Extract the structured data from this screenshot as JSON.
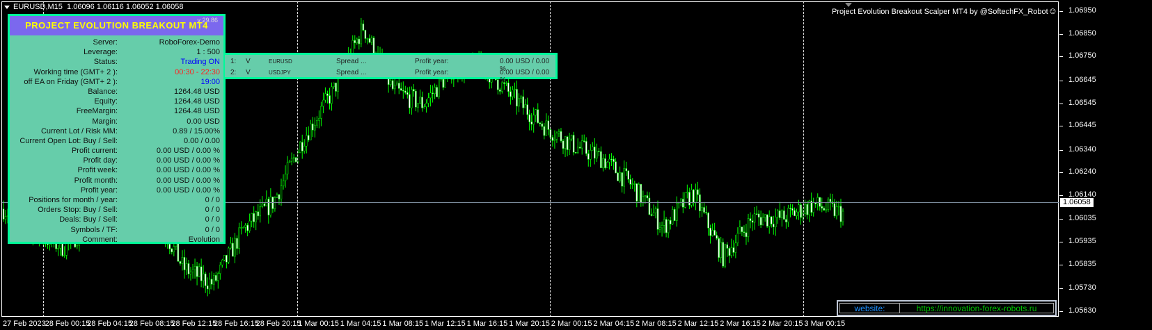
{
  "header": {
    "symbol": "EURUSD,M15",
    "ohlc": "1.06096 1.06116 1.06052 1.06058",
    "title_right": "Project Evolution Breakout Scalper MT4 by @SoftechFX_Robot",
    "smiley": "☺"
  },
  "panel": {
    "title": "PROJECT EVOLUTION BREAKOUT MT4",
    "version": "v 29.86",
    "rows": [
      {
        "k": "Server:",
        "v": "RoboForex-Demo",
        "c": "#111"
      },
      {
        "k": "Leverage:",
        "v": "1 : 500",
        "c": "#111"
      },
      {
        "k": "Status:",
        "v": "Trading ON",
        "c": "#0000ff"
      },
      {
        "k": "Working time (GMT+ 2 ):",
        "v": "00:30 - 22:30",
        "c": "#ff2020"
      },
      {
        "k": "off EA on Friday (GMT+ 2 ):",
        "v": "19:00",
        "c": "#0000ff"
      },
      {
        "k": "Balance:",
        "v": "1264.48 USD",
        "c": "#111"
      },
      {
        "k": "Equity:",
        "v": "1264.48 USD",
        "c": "#111"
      },
      {
        "k": "FreeMargin:",
        "v": "1264.48 USD",
        "c": "#111"
      },
      {
        "k": "Margin:",
        "v": "0.00 USD",
        "c": "#111"
      },
      {
        "k": "Current Lot / Risk MM:",
        "v": "0.89 / 15.00%",
        "c": "#111"
      },
      {
        "k": "Current Open Lot: Buy / Sell:",
        "v": "0.00  /  0.00",
        "c": "#111"
      },
      {
        "k": "Profit current:",
        "v": "0.00 USD / 0.00 %",
        "c": "#111"
      },
      {
        "k": "Profit day:",
        "v": "0.00 USD / 0.00 %",
        "c": "#111"
      },
      {
        "k": "Profit week:",
        "v": "0.00 USD / 0.00 %",
        "c": "#111"
      },
      {
        "k": "Profit month:",
        "v": "0.00 USD / 0.00 %",
        "c": "#111"
      },
      {
        "k": "Profit year:",
        "v": "0.00 USD / 0.00 %",
        "c": "#111"
      },
      {
        "k": "Positions for month / year:",
        "v": "0  /  0",
        "c": "#111"
      },
      {
        "k": "Orders Stop: Buy / Sell:",
        "v": "0  /  0",
        "c": "#111"
      },
      {
        "k": "Deals: Buy / Sell:",
        "v": "0  /  0",
        "c": "#111"
      },
      {
        "k": "Symbols / TF:",
        "v": "0  /  0",
        "c": "#111"
      },
      {
        "k": "Comment:",
        "v": "Evolution",
        "c": "#111"
      }
    ]
  },
  "symbols_panel": [
    {
      "n": "1:",
      "flag": "V",
      "sym": "EURUSD",
      "spread": "Spread ...",
      "pl": "Profit year:",
      "pv": "0.00 USD / 0.00 %"
    },
    {
      "n": "2:",
      "flag": "V",
      "sym": "USDJPY",
      "spread": "Spread ...",
      "pl": "Profit year:",
      "pv": "0.00 USD / 0.00 %"
    }
  ],
  "website": {
    "label": "website:",
    "url": "https://innovation-forex-robots.ru"
  },
  "chart_data": {
    "type": "candlestick",
    "symbol": "EURUSD",
    "timeframe": "M15",
    "current_price": "1.06058",
    "price_labels": [
      "1.06950",
      "1.06850",
      "1.06750",
      "1.06645",
      "1.06545",
      "1.06445",
      "1.06340",
      "1.06240",
      "1.06140",
      "1.06035",
      "1.05935",
      "1.05835",
      "1.05730",
      "1.05630"
    ],
    "time_labels": [
      "27 Feb 2023",
      "28 Feb 00:15",
      "28 Feb 04:15",
      "28 Feb 08:15",
      "28 Feb 12:15",
      "28 Feb 16:15",
      "28 Feb 20:15",
      "1 Mar 00:15",
      "1 Mar 04:15",
      "1 Mar 08:15",
      "1 Mar 12:15",
      "1 Mar 16:15",
      "1 Mar 20:15",
      "2 Mar 00:15",
      "2 Mar 04:15",
      "2 Mar 08:15",
      "2 Mar 12:15",
      "2 Mar 16:15",
      "2 Mar 20:15",
      "3 Mar 00:15"
    ],
    "close_path": [
      1.0608,
      1.0598,
      1.0591,
      1.0603,
      1.0617,
      1.0608,
      1.0582,
      1.0575,
      1.0599,
      1.0611,
      1.0639,
      1.066,
      1.0688,
      1.066,
      1.0654,
      1.067,
      1.0671,
      1.0657,
      1.0645,
      1.0636,
      1.063,
      1.0618,
      1.06,
      1.0615,
      1.0587,
      1.0604,
      1.0604,
      1.061,
      1.0606
    ],
    "colors": {
      "up": "#00ff00",
      "down": "#00ff00",
      "bg": "#000000"
    }
  }
}
